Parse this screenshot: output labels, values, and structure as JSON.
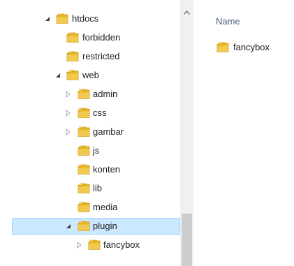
{
  "navigation": {
    "items": [
      {
        "id": "htdocs",
        "label": "htdocs",
        "level": 0,
        "expander": "expanded",
        "selected": false
      },
      {
        "id": "forbidden",
        "label": "forbidden",
        "level": 1,
        "expander": "none",
        "selected": false
      },
      {
        "id": "restricted",
        "label": "restricted",
        "level": 1,
        "expander": "none",
        "selected": false
      },
      {
        "id": "web",
        "label": "web",
        "level": 1,
        "expander": "expanded",
        "selected": false
      },
      {
        "id": "admin",
        "label": "admin",
        "level": 2,
        "expander": "collapsed",
        "selected": false
      },
      {
        "id": "css",
        "label": "css",
        "level": 2,
        "expander": "collapsed",
        "selected": false
      },
      {
        "id": "gambar",
        "label": "gambar",
        "level": 2,
        "expander": "collapsed",
        "selected": false
      },
      {
        "id": "js",
        "label": "js",
        "level": 2,
        "expander": "none",
        "selected": false
      },
      {
        "id": "konten",
        "label": "konten",
        "level": 2,
        "expander": "none",
        "selected": false
      },
      {
        "id": "lib",
        "label": "lib",
        "level": 2,
        "expander": "none",
        "selected": false
      },
      {
        "id": "media",
        "label": "media",
        "level": 2,
        "expander": "none",
        "selected": false
      },
      {
        "id": "plugin",
        "label": "plugin",
        "level": 2,
        "expander": "expanded",
        "selected": true
      },
      {
        "id": "fancybox",
        "label": "fancybox",
        "level": 3,
        "expander": "collapsed",
        "selected": false
      }
    ]
  },
  "content": {
    "column_header": "Name",
    "files": [
      {
        "label": "fancybox",
        "type": "folder"
      }
    ]
  },
  "colors": {
    "selection_fill": "#cce8ff",
    "selection_border": "#99d1ff",
    "folder_body": "#e8b923",
    "folder_light": "#f8d775",
    "header_text": "#4c607a"
  },
  "icons": {
    "folder": "folder-icon",
    "expanded": "expanded-arrow-icon",
    "collapsed": "collapsed-arrow-icon",
    "scroll_up": "scroll-up-arrow-icon"
  }
}
